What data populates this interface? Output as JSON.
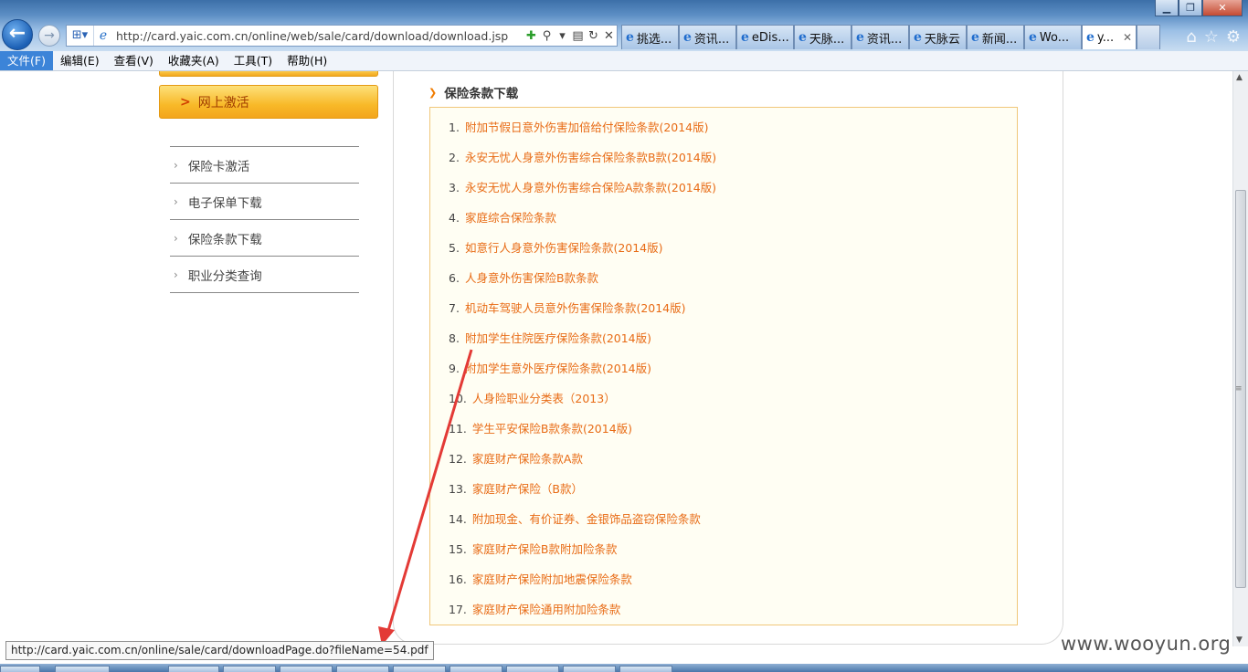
{
  "browser": {
    "url": "http://card.yaic.com.cn/online/web/sale/card/download/download.jsp",
    "tabs": [
      {
        "label": "挑选...",
        "active": false
      },
      {
        "label": "资讯...",
        "active": false
      },
      {
        "label": "eDis...",
        "active": false
      },
      {
        "label": "天脉...",
        "active": false
      },
      {
        "label": "资讯...",
        "active": false
      },
      {
        "label": "天脉云",
        "active": false
      },
      {
        "label": "新闻...",
        "active": false
      },
      {
        "label": "Wo...",
        "active": false
      },
      {
        "label": "y...",
        "active": true
      }
    ],
    "menu": [
      "文件(F)",
      "编辑(E)",
      "查看(V)",
      "收藏夹(A)",
      "工具(T)",
      "帮助(H)"
    ],
    "icons": {
      "back": "back-arrow-icon",
      "forward": "forward-arrow-icon",
      "home": "home-icon",
      "favorites": "star-icon",
      "tools": "gear-icon"
    }
  },
  "sidebar": {
    "active_item": "网上激活",
    "items": [
      "保险卡激活",
      "电子保单下载",
      "保险条款下载",
      "职业分类查询"
    ]
  },
  "main": {
    "section_title": "保险条款下载",
    "documents": [
      {
        "num": "1.",
        "title": "附加节假日意外伤害加倍给付保险条款(2014版)"
      },
      {
        "num": "2.",
        "title": "永安无忧人身意外伤害综合保险条款B款(2014版)"
      },
      {
        "num": "3.",
        "title": "永安无忧人身意外伤害综合保险A款条款(2014版)"
      },
      {
        "num": "4.",
        "title": "家庭综合保险条款"
      },
      {
        "num": "5.",
        "title": "如意行人身意外伤害保险条款(2014版)"
      },
      {
        "num": "6.",
        "title": "人身意外伤害保险B款条款"
      },
      {
        "num": "7.",
        "title": "机动车驾驶人员意外伤害保险条款(2014版)"
      },
      {
        "num": "8.",
        "title": "附加学生住院医疗保险条款(2014版)"
      },
      {
        "num": "9.",
        "title": "附加学生意外医疗保险条款(2014版)"
      },
      {
        "num": "10.",
        "title": "人身险职业分类表（2013）"
      },
      {
        "num": "11.",
        "title": "学生平安保险B款条款(2014版)"
      },
      {
        "num": "12.",
        "title": "家庭财产保险条款A款"
      },
      {
        "num": "13.",
        "title": "家庭财产保险（B款）"
      },
      {
        "num": "14.",
        "title": "附加现金、有价证券、金银饰品盗窃保险条款"
      },
      {
        "num": "15.",
        "title": "家庭财产保险B款附加险条款"
      },
      {
        "num": "16.",
        "title": "家庭财产保险附加地震保险条款"
      },
      {
        "num": "17.",
        "title": "家庭财产保险通用附加险条款"
      }
    ]
  },
  "status_url": "http://card.yaic.com.cn/online/sale/card/downloadPage.do?fileName=54.pdf",
  "watermark": "www.wooyun.org",
  "colors": {
    "link": "#e86b15",
    "accent_orange": "#f3a51c",
    "annotation_arrow": "#e33a36"
  }
}
